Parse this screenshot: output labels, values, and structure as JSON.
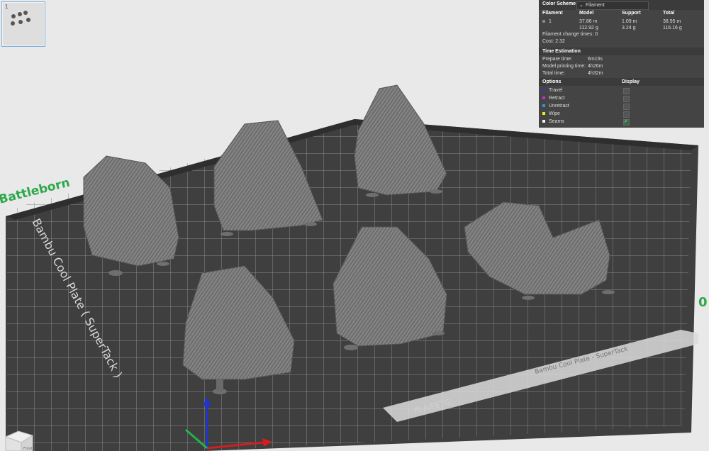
{
  "scene": {
    "brand_label": "Battleborn",
    "plate_label": "Bambu Cool Plate ( SuperTack )",
    "plate_front_label": "Bambu Cool Plate - SuperTack",
    "plate_code": "PLA/PETG",
    "right_digit": "0",
    "plate_number": "1",
    "view_cube_label": "Front"
  },
  "panel": {
    "color_scheme_label": "Color Scheme",
    "color_scheme_value": "Filament",
    "headers": {
      "filament": "Filament",
      "model": "Model",
      "support": "Support",
      "total": "Total"
    },
    "filament_row": {
      "id": "1",
      "model_len": "37.86 m",
      "model_weight": "112.92 g",
      "support_len": "1.09 m",
      "support_weight": "3.24 g",
      "total_len": "38.95 m",
      "total_weight": "116.16 g"
    },
    "filament_change": "Filament change times:  0",
    "cost": "Cost:  2.32",
    "time_title": "Time Estimation",
    "prepare_label": "Prepare time:",
    "prepare_value": "6m15s",
    "model_time_label": "Model printing time:",
    "model_time_value": "4h26m",
    "total_time_label": "Total time:",
    "total_time_value": "4h32m",
    "options_title": "Options",
    "display_title": "Display",
    "options": [
      {
        "label": "Travel",
        "color": "#2b3bbb",
        "checked": false
      },
      {
        "label": "Retract",
        "color": "#c231c2",
        "checked": false
      },
      {
        "label": "Unretract",
        "color": "#3a8fd8",
        "checked": false
      },
      {
        "label": "Wipe",
        "color": "#f0e820",
        "checked": false
      },
      {
        "label": "Seams",
        "color": "#f2f2f2",
        "checked": true
      }
    ]
  }
}
